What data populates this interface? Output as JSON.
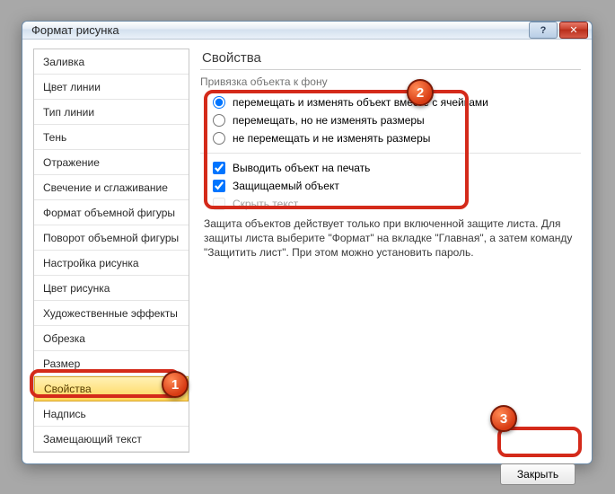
{
  "window": {
    "title": "Формат рисунка",
    "help_symbol": "?",
    "close_symbol": "✕"
  },
  "sidebar": {
    "items": [
      {
        "label": "Заливка"
      },
      {
        "label": "Цвет линии"
      },
      {
        "label": "Тип линии"
      },
      {
        "label": "Тень"
      },
      {
        "label": "Отражение"
      },
      {
        "label": "Свечение и сглаживание"
      },
      {
        "label": "Формат объемной фигуры"
      },
      {
        "label": "Поворот объемной фигуры"
      },
      {
        "label": "Настройка рисунка"
      },
      {
        "label": "Цвет рисунка"
      },
      {
        "label": "Художественные эффекты"
      },
      {
        "label": "Обрезка"
      },
      {
        "label": "Размер"
      },
      {
        "label": "Свойства",
        "selected": true
      },
      {
        "label": "Надпись"
      },
      {
        "label": "Замещающий текст"
      }
    ]
  },
  "pane": {
    "title": "Свойства",
    "group_label": "Привязка объекта к фону",
    "radios": [
      {
        "label": "перемещать и изменять объект вместе с ячейками",
        "checked": true
      },
      {
        "label": "перемещать, но не изменять размеры",
        "checked": false
      },
      {
        "label": "не перемещать и не изменять размеры",
        "checked": false
      }
    ],
    "checks": [
      {
        "label": "Выводить объект на печать",
        "checked": true,
        "disabled": false
      },
      {
        "label": "Защищаемый объект",
        "checked": true,
        "disabled": false
      },
      {
        "label": "Скрыть текст",
        "checked": false,
        "disabled": true
      }
    ],
    "note": "Защита объектов действует только при включенной защите листа. Для защиты листа выберите \"Формат\" на вкладке \"Главная\", а затем команду \"Защитить лист\". При этом можно установить пароль."
  },
  "footer": {
    "close_label": "Закрыть"
  },
  "badges": {
    "b1": "1",
    "b2": "2",
    "b3": "3"
  }
}
